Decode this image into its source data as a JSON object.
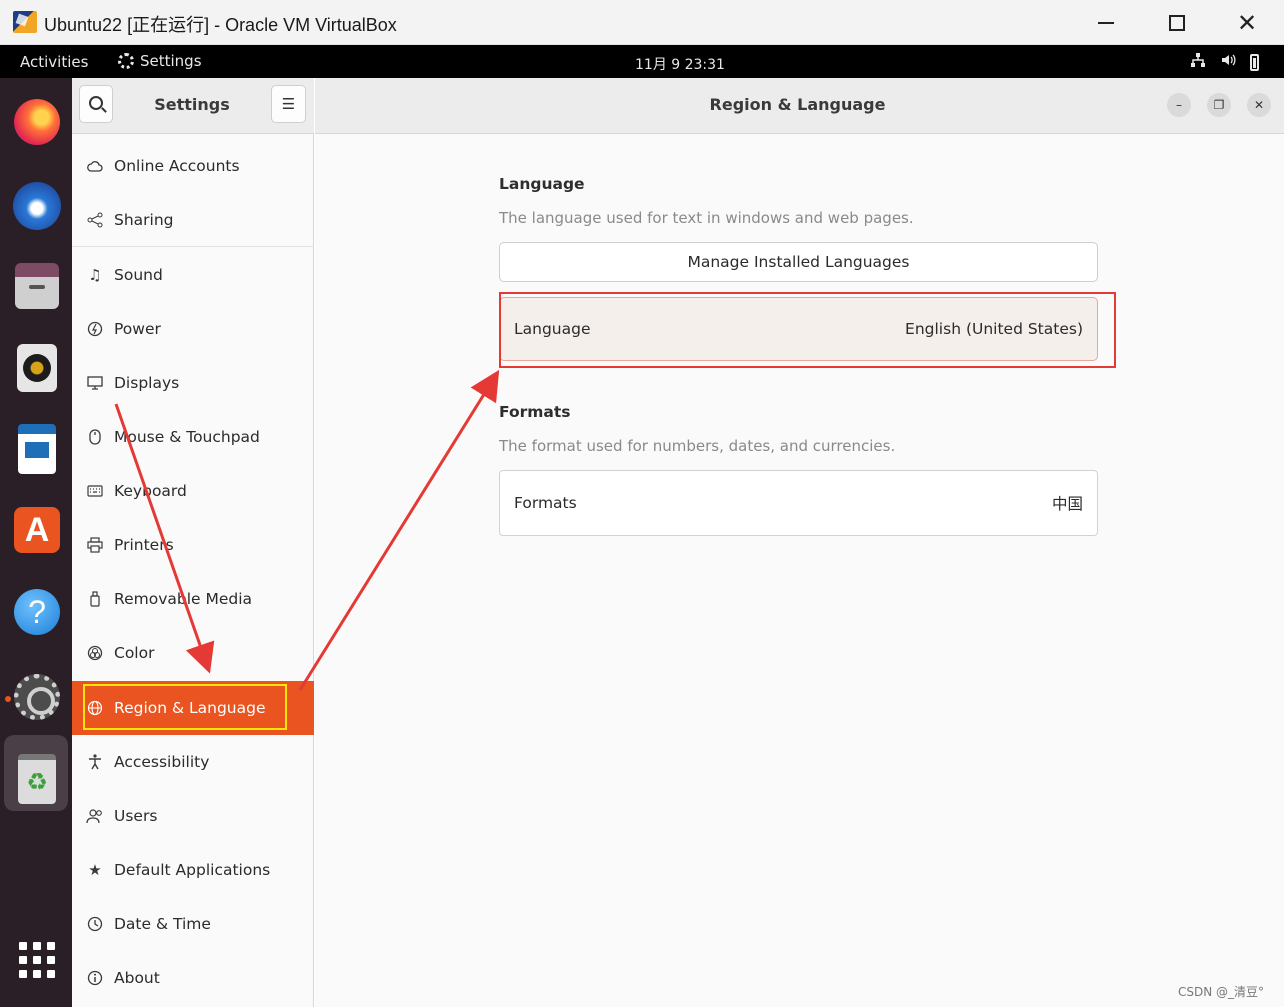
{
  "host_window": {
    "title": "Ubuntu22 [正在运行] - Oracle VM VirtualBox"
  },
  "top_bar": {
    "activities": "Activities",
    "app_name": "Settings",
    "clock": "11月 9  23:31"
  },
  "sidebar": {
    "title": "Settings",
    "menu_glyph": "☰",
    "items": [
      {
        "label": "Online Accounts",
        "icon": "cloud-icon"
      },
      {
        "label": "Sharing",
        "icon": "share-icon"
      },
      {
        "label": "Sound",
        "icon": "music-note-icon"
      },
      {
        "label": "Power",
        "icon": "power-icon"
      },
      {
        "label": "Displays",
        "icon": "display-icon"
      },
      {
        "label": "Mouse & Touchpad",
        "icon": "mouse-icon"
      },
      {
        "label": "Keyboard",
        "icon": "keyboard-icon"
      },
      {
        "label": "Printers",
        "icon": "printer-icon"
      },
      {
        "label": "Removable Media",
        "icon": "usb-icon"
      },
      {
        "label": "Color",
        "icon": "color-icon"
      },
      {
        "label": "Region & Language",
        "icon": "globe-icon",
        "active": true
      },
      {
        "label": "Accessibility",
        "icon": "accessibility-icon"
      },
      {
        "label": "Users",
        "icon": "users-icon"
      },
      {
        "label": "Default Applications",
        "icon": "star-icon"
      },
      {
        "label": "Date & Time",
        "icon": "clock-icon"
      },
      {
        "label": "About",
        "icon": "info-icon"
      }
    ]
  },
  "main": {
    "title": "Region & Language",
    "language_section": {
      "title": "Language",
      "description": "The language used for text in windows and web pages.",
      "manage_button": "Manage Installed Languages",
      "row_label": "Language",
      "row_value": "English (United States)"
    },
    "formats_section": {
      "title": "Formats",
      "description": "The format used for numbers, dates, and currencies.",
      "row_label": "Formats",
      "row_value": "中国"
    }
  },
  "watermark": "CSDN @_清豆°",
  "colors": {
    "accent": "#e95420",
    "highlight_red": "#e53935",
    "highlight_yellow": "#ffe600",
    "dock_bg": "#2a1f27"
  }
}
